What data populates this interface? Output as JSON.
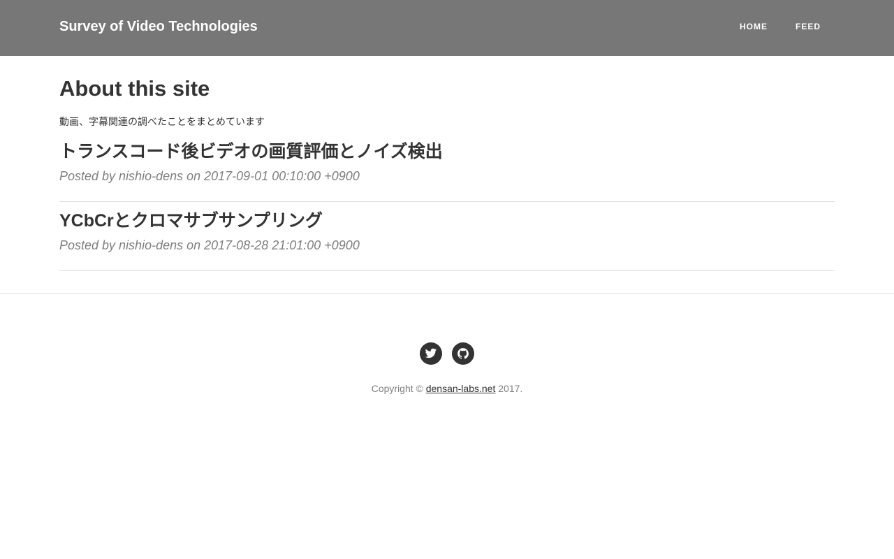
{
  "header": {
    "brand": "Survey of Video Technologies",
    "nav": [
      {
        "label": "HOME"
      },
      {
        "label": "FEED"
      }
    ]
  },
  "main": {
    "title": "About this site",
    "intro": "動画、字幕関連の調べたことをまとめています",
    "posts": [
      {
        "title": "トランスコード後ビデオの画質評価とノイズ検出",
        "meta": "Posted by nishio-dens on 2017-09-01 00:10:00 +0900"
      },
      {
        "title": "YCbCrとクロマサブサンプリング",
        "meta": "Posted by nishio-dens on 2017-08-28 21:01:00 +0900"
      }
    ]
  },
  "footer": {
    "social": [
      {
        "icon": "twitter-icon"
      },
      {
        "icon": "github-icon"
      }
    ],
    "copyright_prefix": "Copyright ©",
    "copyright_link": "densan-labs.net",
    "copyright_suffix": "2017."
  }
}
